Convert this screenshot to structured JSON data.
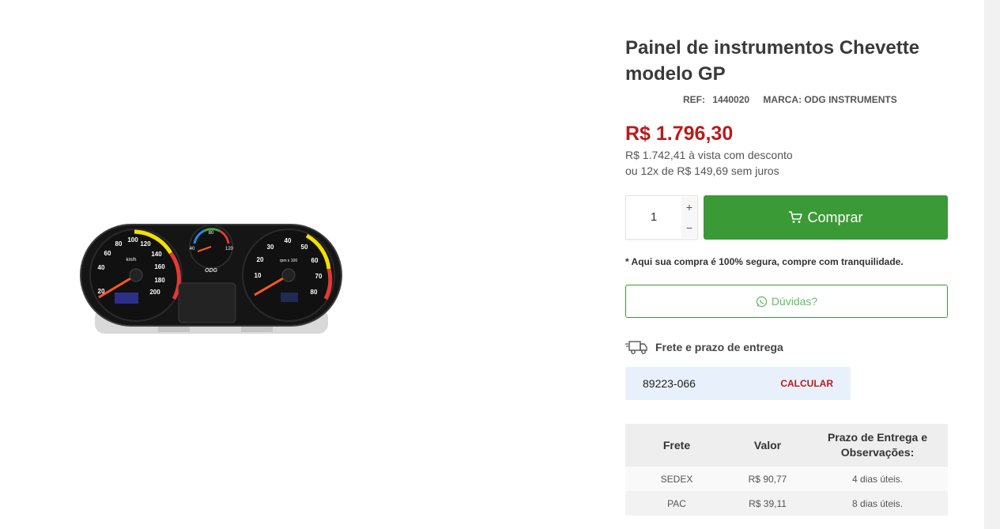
{
  "product": {
    "title": "Painel de instrumentos Chevette modelo GP",
    "ref_label": "REF:",
    "ref_value": "1440020",
    "brand": "MARCA: ODG INSTRUMENTS",
    "price": "R$ 1.796,30",
    "cash_price": "R$ 1.742,41 à vista com desconto",
    "installments": "ou 12x de R$ 149,69 sem juros"
  },
  "gauge": {
    "brand_text": "ODG",
    "speed_unit": "km/h",
    "speed_ticks": [
      "20",
      "40",
      "60",
      "80",
      "100",
      "120",
      "140",
      "160",
      "180",
      "200"
    ],
    "rpm_unit": "rpm x 100",
    "rpm_ticks": [
      "10",
      "20",
      "30",
      "40",
      "50",
      "60",
      "70",
      "80"
    ],
    "temp_ticks": [
      "40",
      "80",
      "120"
    ]
  },
  "purchase": {
    "quantity": "1",
    "plus": "+",
    "minus": "−",
    "buy_label": "Comprar",
    "secure_note": "* Aqui sua compra é 100% segura, compre com tranquilidade.",
    "doubts_label": "Dúvidas?"
  },
  "shipping": {
    "heading": "Frete e prazo de entrega",
    "cep_value": "89223-066",
    "calc_label": "CALCULAR",
    "columns": [
      "Frete",
      "Valor",
      "Prazo de Entrega e Observações:"
    ],
    "rows": [
      {
        "service": "SEDEX",
        "price": "R$ 90,77",
        "term": "4 dias úteis."
      },
      {
        "service": "PAC",
        "price": "R$ 39,11",
        "term": "8 dias úteis."
      }
    ]
  },
  "colors": {
    "price": "#b71c1c",
    "buy_button": "#3a9a35",
    "doubts_border": "#3a9a35",
    "cep_background": "#e8f1fb"
  },
  "icons": [
    "cart-icon",
    "whatsapp-icon",
    "truck-icon"
  ]
}
